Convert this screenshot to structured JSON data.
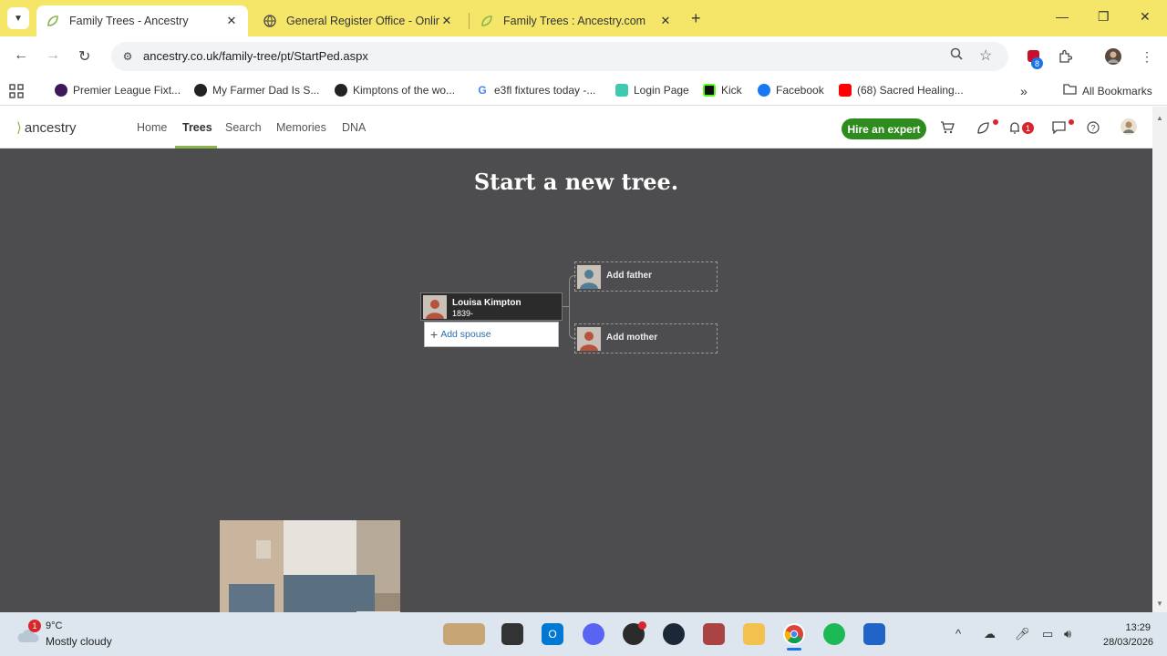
{
  "browser": {
    "tabs": [
      {
        "title": "Family Trees - Ancestry",
        "active": true
      },
      {
        "title": "General Register Office - Online",
        "active": false
      },
      {
        "title": "Family Trees : Ancestry.com",
        "active": false
      }
    ],
    "address": {
      "url": "ancestry.co.uk/family-tree/pt/StartPed.aspx"
    },
    "extensions": {
      "badge_count": "8"
    },
    "bookmarks": [
      {
        "label": "Premier League Fixt...",
        "color": "#3d195b"
      },
      {
        "label": "My Farmer Dad Is S...",
        "color": "#222222"
      },
      {
        "label": "Kimptons of the wo...",
        "color": "#222222"
      },
      {
        "label": "e3fl fixtures today -...",
        "color": "#4285f4"
      },
      {
        "label": "Login Page",
        "color": "#3ec9b0"
      },
      {
        "label": "Kick",
        "color": "#53fc18"
      },
      {
        "label": "Facebook",
        "color": "#1877f2"
      },
      {
        "label": "(68) Sacred Healing...",
        "color": "#ff0000"
      }
    ],
    "all_bookmarks_label": "All Bookmarks"
  },
  "site": {
    "logo_text": "ancestry",
    "nav": [
      {
        "label": "Home",
        "active": false
      },
      {
        "label": "Trees",
        "active": true
      },
      {
        "label": "Search",
        "active": false
      },
      {
        "label": "Memories",
        "active": false
      },
      {
        "label": "DNA",
        "active": false
      }
    ],
    "hire_button": "Hire an expert",
    "notification_count": "1",
    "accent_color": "#8ab64a"
  },
  "tree": {
    "heading": "Start a new tree.",
    "person": {
      "name": "Louisa Kimpton",
      "dates": "1839-"
    },
    "add_spouse": "Add spouse",
    "add_father": "Add father",
    "add_mother": "Add mother"
  },
  "taskbar": {
    "weather": {
      "alert_count": "1",
      "temp": "9°C",
      "desc": "Mostly cloudy"
    },
    "time": "13:29",
    "date": "28/03/2026"
  }
}
